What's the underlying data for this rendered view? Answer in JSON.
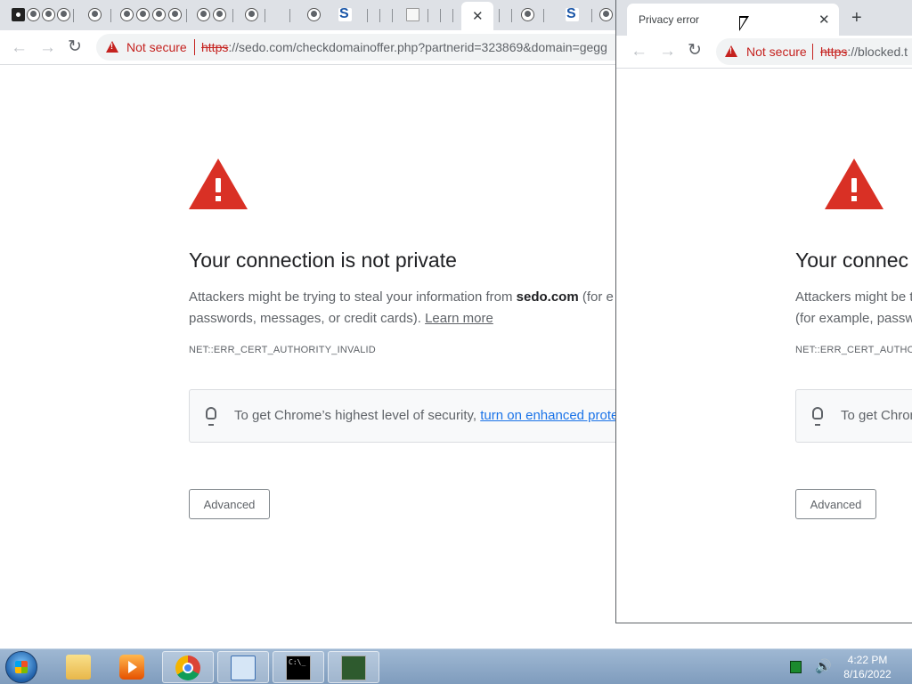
{
  "window_main": {
    "tabs": [
      {
        "favicon": "cat-icon"
      },
      {
        "favicon": "globe-icon"
      },
      {
        "favicon": "globe-icon"
      },
      {
        "favicon": "globe-icon"
      },
      {
        "favicon": "globe-icon"
      },
      {
        "favicon": "globe-icon"
      },
      {
        "favicon": "globe-icon"
      },
      {
        "favicon": "globe-icon"
      },
      {
        "favicon": "globe-icon"
      },
      {
        "favicon": "globe-icon"
      },
      {
        "favicon": "globe-icon"
      },
      {
        "favicon": "globe-icon"
      },
      {
        "favicon": "sedo-icon"
      },
      {
        "favicon": "blank-page-icon"
      },
      {
        "favicon": "globe-icon"
      },
      {
        "favicon": "sedo-icon"
      }
    ],
    "sedo_letter": "S",
    "active_tab_close": "✕",
    "security_label": "Not secure",
    "url_scheme": "https",
    "url_rest": "://sedo.com/checkdomainoffer.php?partnerid=323869&domain=gegg",
    "heading": "Your connection is not private",
    "para_line1_prefix": "Attackers might be trying to steal your information from ",
    "para_domain": "sedo.com",
    "para_line1_suffix": " (for e",
    "para_line2": "passwords, messages, or credit cards). ",
    "learn_more": "Learn more",
    "error_code": "NET::ERR_CERT_AUTHORITY_INVALID",
    "hint_text": "To get Chrome’s highest level of security, ",
    "hint_link": "turn on enhanced prote",
    "advanced_label": "Advanced"
  },
  "window_popup": {
    "tab_title": "Privacy error",
    "tab_close": "✕",
    "new_tab": "+",
    "security_label": "Not secure",
    "url_scheme": "https",
    "url_rest": "://blocked.t",
    "heading": "Your connec",
    "para_line1": "Attackers might be t",
    "para_line2": "(for example, passw",
    "error_code": "NET::ERR_CERT_AUTHOR",
    "hint_text": "To get Chrom",
    "advanced_label": "Advanced"
  },
  "nav_icons": {
    "back": "←",
    "forward": "→",
    "reload": "↻"
  },
  "taskbar": {
    "pinned": [
      "folder-icon",
      "media-player-icon",
      "chrome-icon",
      "control-panel-icon",
      "command-prompt-icon",
      "task-manager-icon"
    ],
    "tray_volume": "🔊",
    "clock_time": "4:22 PM",
    "clock_date": "8/16/2022"
  },
  "colors": {
    "danger": "#d93025",
    "link": "#1a73e8",
    "tabstrip": "#dee1e6",
    "taskbar": "#8aa7c7"
  }
}
